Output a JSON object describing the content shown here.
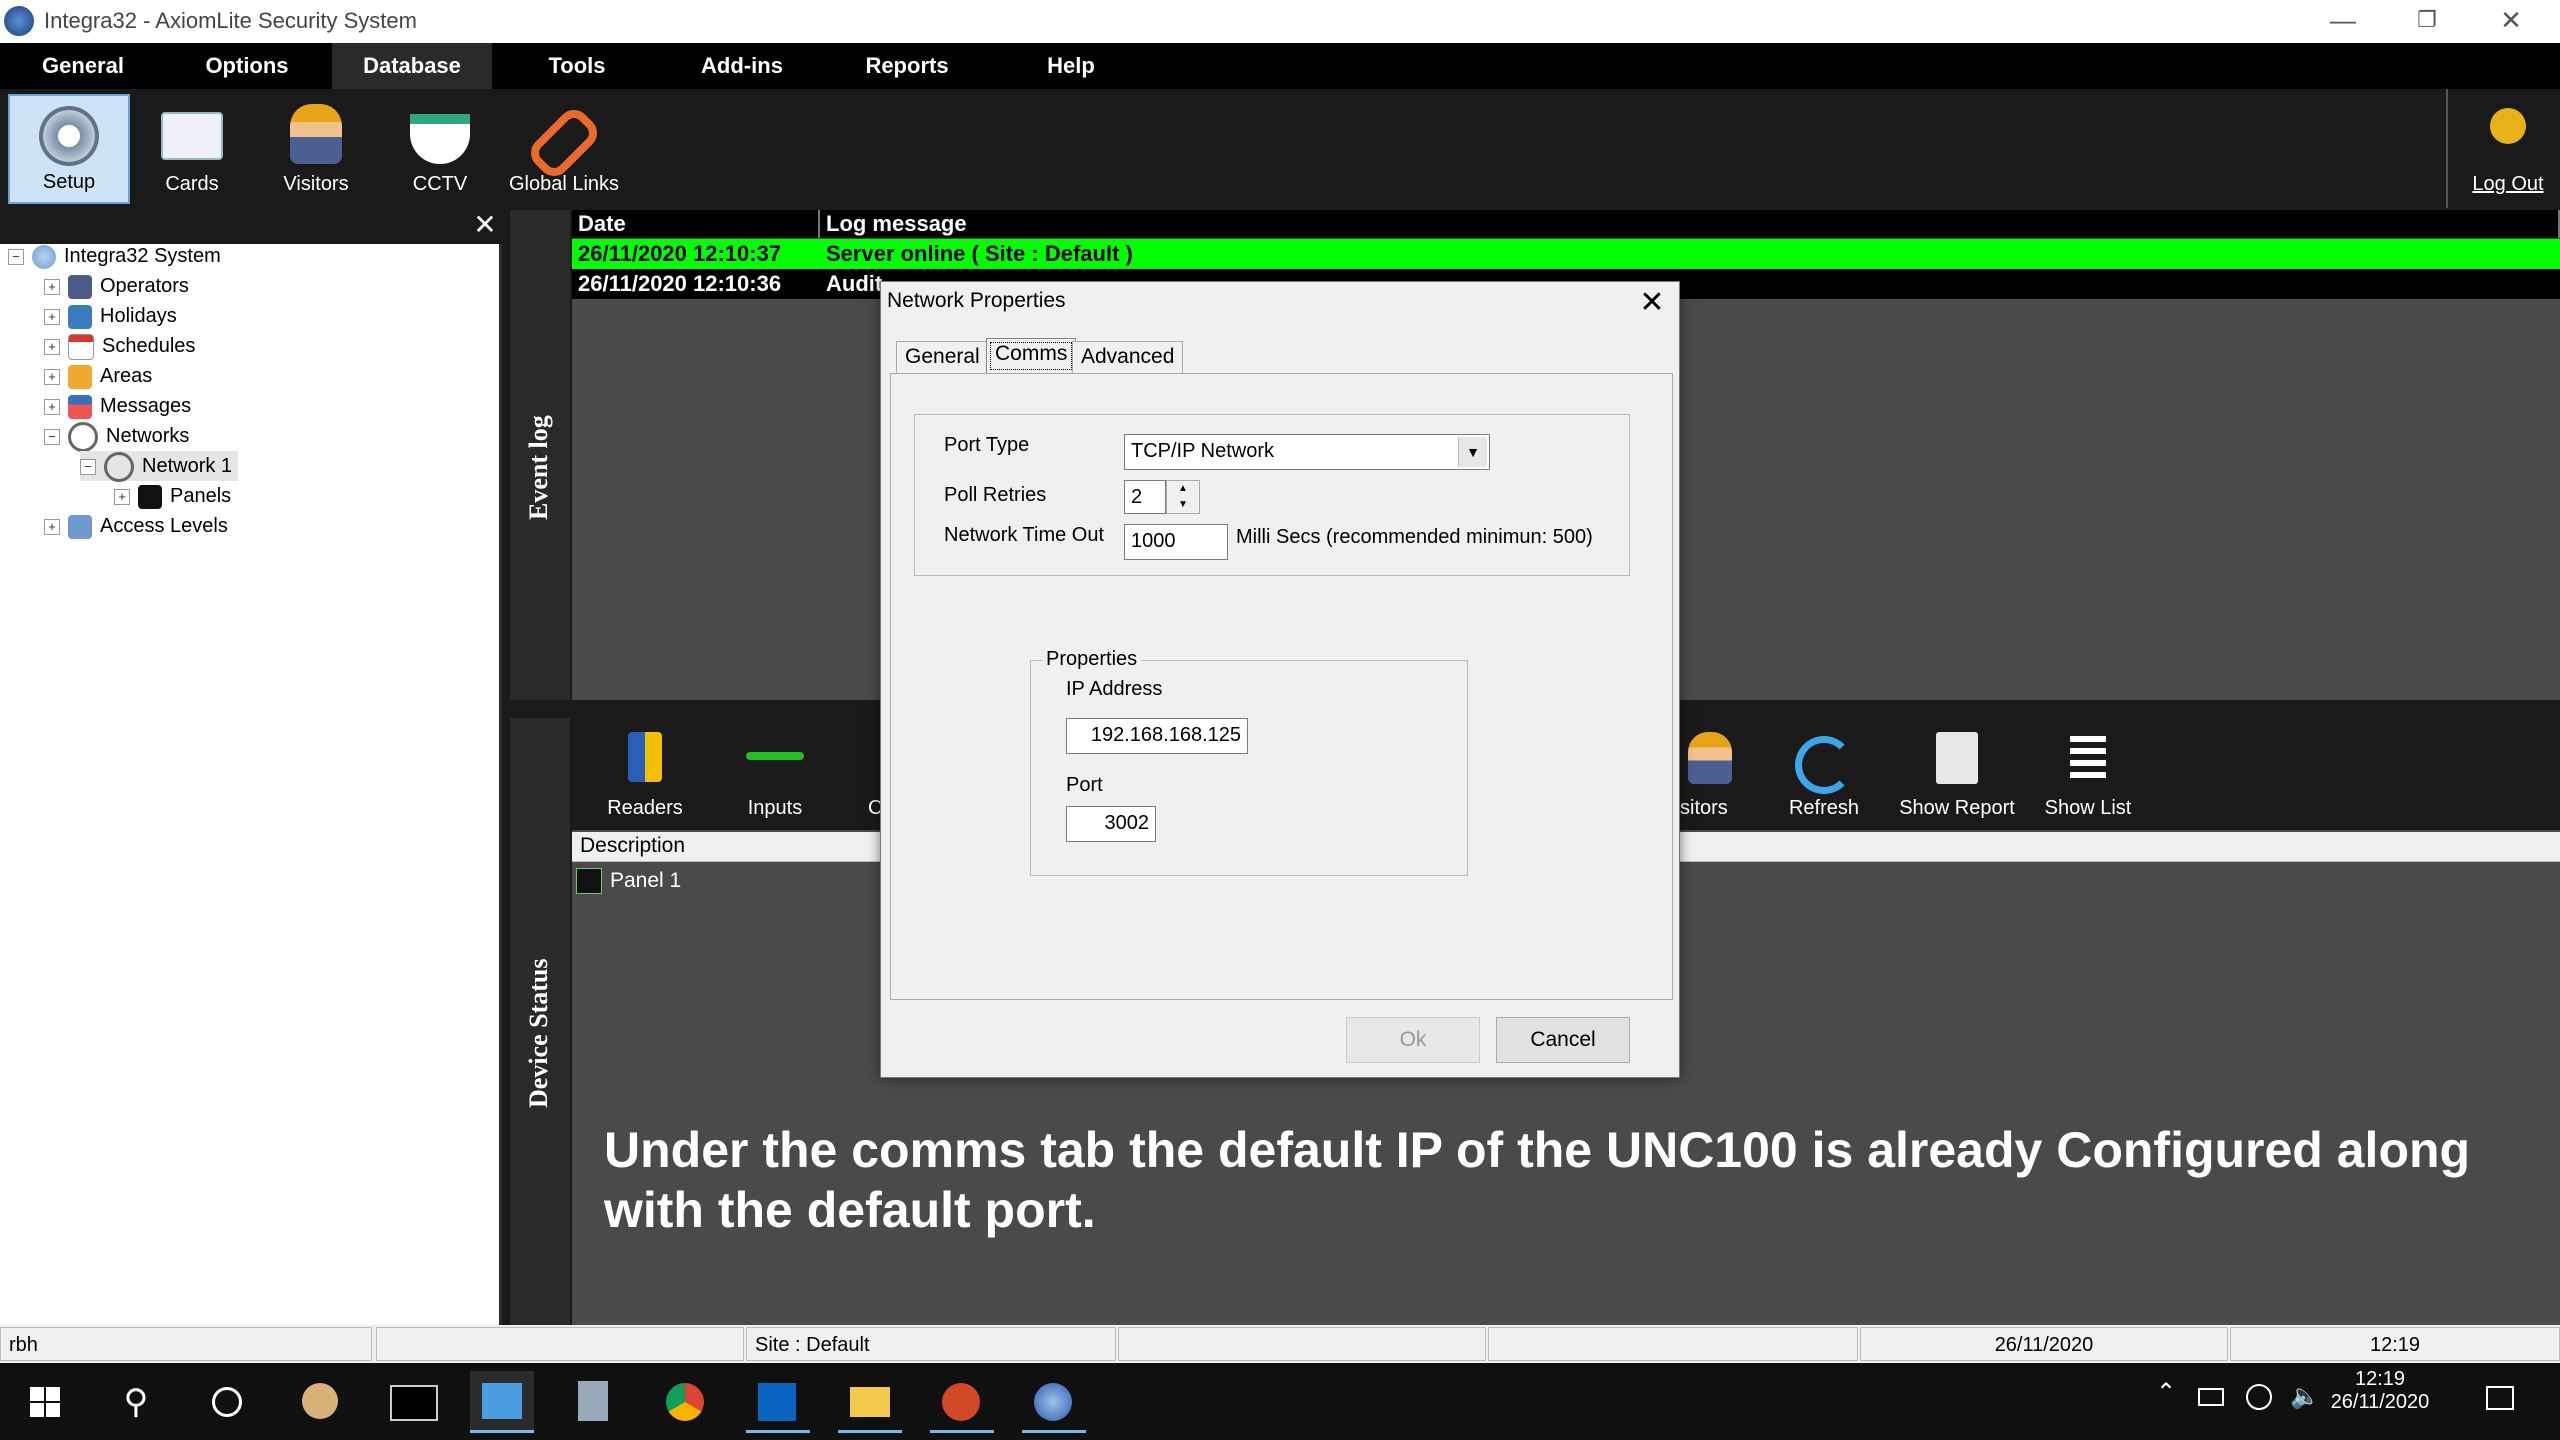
{
  "window": {
    "title": "Integra32 - AxiomLite Security System"
  },
  "menu": [
    "General",
    "Options",
    "Database",
    "Tools",
    "Add-ins",
    "Reports",
    "Help"
  ],
  "toolbar": {
    "setup": "Setup",
    "cards": "Cards",
    "visitors": "Visitors",
    "cctv": "CCTV",
    "global_links": "Global Links",
    "logout": "Log Out"
  },
  "tree": {
    "root": "Integra32 System",
    "items": [
      "Operators",
      "Holidays",
      "Schedules",
      "Areas",
      "Messages",
      "Networks"
    ],
    "network1": "Network 1",
    "panels": "Panels",
    "access_levels": "Access Levels"
  },
  "event_log": {
    "label": "Event log",
    "col_date": "Date",
    "col_message": "Log message",
    "rows": [
      {
        "date": "26/11/2020 12:10:37",
        "message": "Server online ( Site : Default )"
      },
      {
        "date": "26/11/2020 12:10:36",
        "message": "Audit"
      }
    ]
  },
  "device_status": {
    "label": "Device Status",
    "tools": {
      "readers": "Readers",
      "inputs": "Inputs",
      "c": "C",
      "visitors": "sitors",
      "refresh": "Refresh",
      "show_report": "Show Report",
      "show_list": "Show List"
    },
    "col_description": "Description",
    "rows": [
      "Panel 1"
    ]
  },
  "dialog": {
    "title": "Network Properties",
    "tabs": [
      "General",
      "Comms",
      "Advanced"
    ],
    "port_type_label": "Port Type",
    "port_type_value": "TCP/IP Network",
    "poll_retries_label": "Poll Retries",
    "poll_retries_value": "2",
    "timeout_label": "Network Time Out",
    "timeout_value": "1000",
    "timeout_hint": "Milli Secs (recommended minimun: 500)",
    "properties_label": "Properties",
    "ip_label": "IP Address",
    "ip_value": "192.168.168.125",
    "port_label": "Port",
    "port_value": "3002",
    "ok": "Ok",
    "cancel": "Cancel"
  },
  "caption": "Under the comms tab the default IP of the UNC100 is already Configured along with the default port.",
  "statusbar": {
    "user": "rbh",
    "site": "Site : Default",
    "date": "26/11/2020",
    "time": "12:19"
  },
  "taskbar": {
    "time": "12:19",
    "date": "26/11/2020"
  },
  "colors": {
    "log_green": "#00ff00",
    "selected_tool": "#cfe3f7"
  }
}
